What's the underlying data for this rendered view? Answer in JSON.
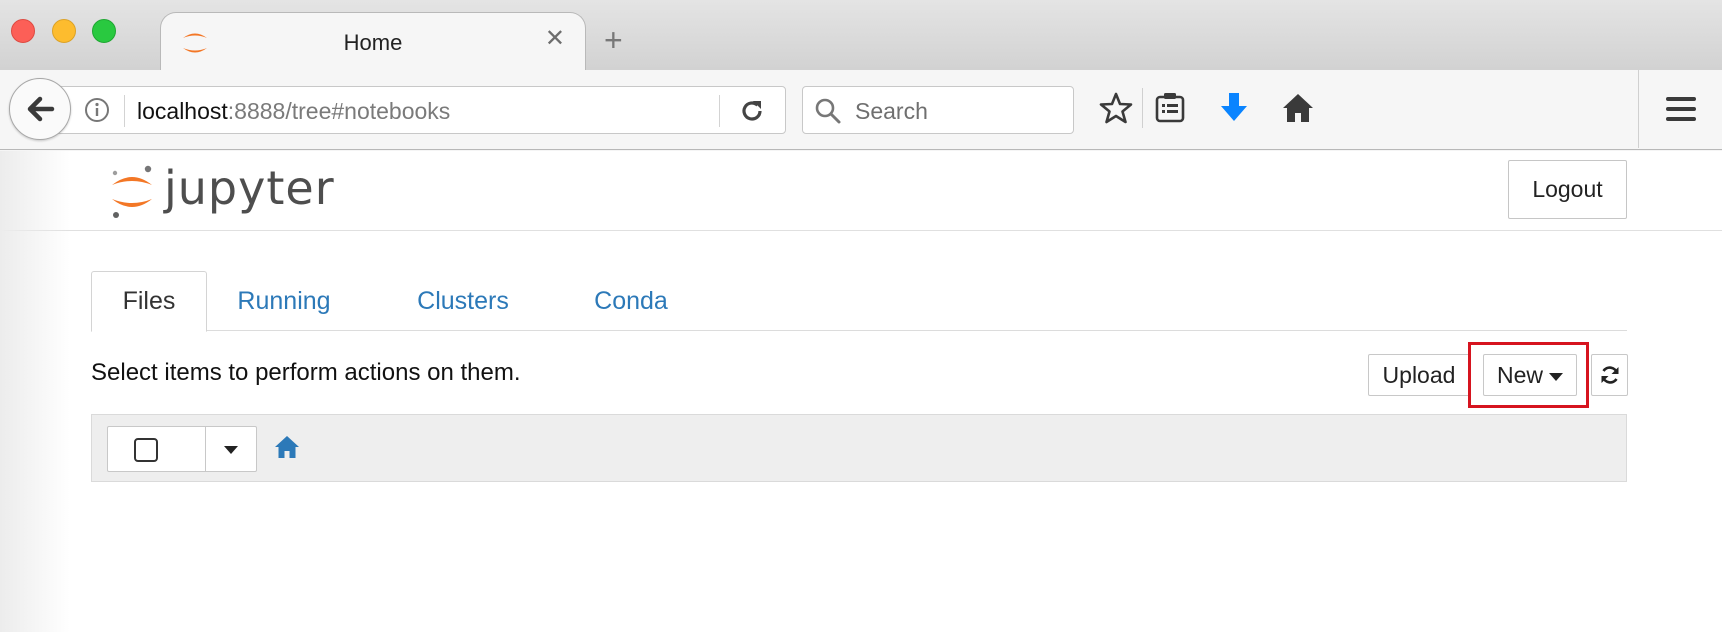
{
  "browser": {
    "tab_title": "Home",
    "url_host": "localhost",
    "url_rest": ":8888/tree#notebooks",
    "search_placeholder": "Search",
    "colors": {
      "close_red": "#fc5f57",
      "minimize_yellow": "#fdbc2e",
      "zoom_green": "#29c940",
      "download_blue": "#0a84ff"
    },
    "icons": [
      "back-arrow-icon",
      "info-icon",
      "reload-icon",
      "search-icon",
      "bookmark-star-icon",
      "reading-list-icon",
      "downloads-icon",
      "home-icon",
      "hamburger-menu-icon"
    ]
  },
  "jupyter": {
    "logo_text": "jupyter",
    "logout_label": "Logout",
    "tabs": [
      {
        "label": "Files",
        "active": true
      },
      {
        "label": "Running",
        "active": false
      },
      {
        "label": "Clusters",
        "active": false
      },
      {
        "label": "Conda",
        "active": false
      }
    ],
    "toolbar_hint": "Select items to perform actions on them.",
    "upload_label": "Upload",
    "new_label": "New",
    "colors": {
      "link_blue": "#2c79b8",
      "logo_orange": "#f37726",
      "highlight_red": "#d6141f"
    }
  }
}
